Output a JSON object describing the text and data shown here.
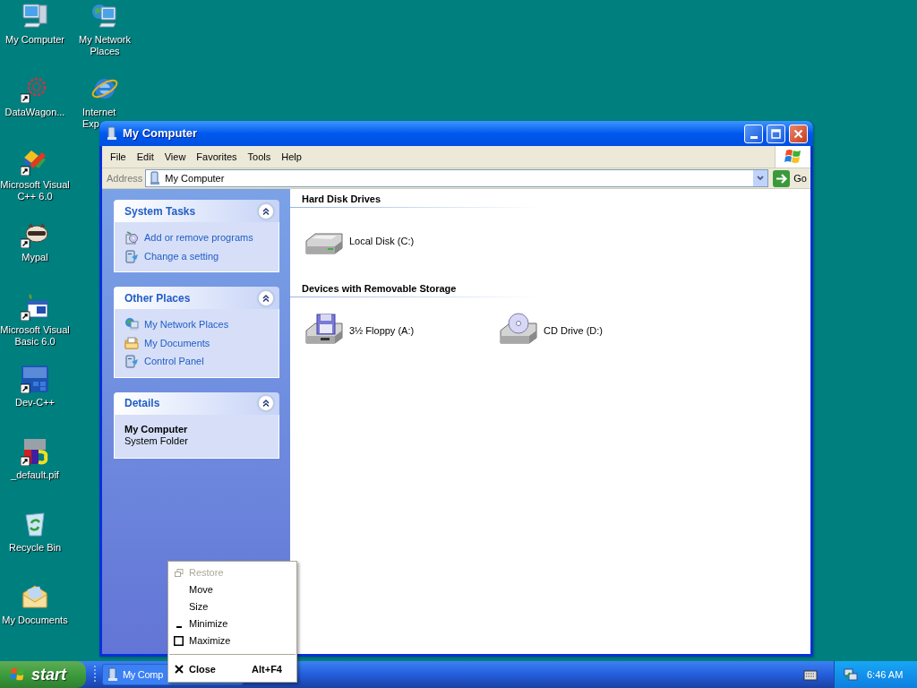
{
  "desktop_icons": [
    {
      "kind": "computer",
      "label": [
        "My Computer"
      ],
      "covered": false
    },
    {
      "kind": "gear-shortcut",
      "label": [
        "DataWagon..."
      ],
      "covered": false
    },
    {
      "kind": "cube-shortcut",
      "label": [
        "Microsoft Visual",
        "C++ 6.0"
      ],
      "covered": false
    },
    {
      "kind": "raccoon-shortcut",
      "label": [
        "Mypal"
      ],
      "covered": false
    },
    {
      "kind": "window-shortcut",
      "label": [
        "Microsoft Visual",
        "Basic 6.0"
      ],
      "covered": false
    },
    {
      "kind": "tile-shortcut",
      "label": [
        "Dev-C++"
      ],
      "covered": false
    },
    {
      "kind": "dos-shortcut",
      "label": [
        "_default.pif"
      ],
      "covered": false
    },
    {
      "kind": "recycle",
      "label": [
        "Recycle Bin"
      ],
      "covered": false
    },
    {
      "kind": "documents",
      "label": [
        "My Documents"
      ],
      "covered": false
    },
    {
      "kind": "network",
      "label": [
        "My Network",
        "Places"
      ],
      "covered": false
    },
    {
      "kind": "globe",
      "label": [
        "Internet",
        "Exp"
      ],
      "covered": true
    }
  ],
  "window": {
    "title": "My Computer",
    "menu": [
      "File",
      "Edit",
      "View",
      "Favorites",
      "Tools",
      "Help"
    ],
    "address": {
      "label": "Address",
      "value": "My Computer",
      "go": "Go"
    },
    "task_panels": [
      {
        "kind": "links",
        "title": "System Tasks",
        "expanded": true,
        "items": [
          {
            "kind": "programs",
            "label": "Add or remove programs"
          },
          {
            "kind": "settings",
            "label": "Change a setting"
          }
        ]
      },
      {
        "kind": "links",
        "title": "Other Places",
        "expanded": true,
        "items": [
          {
            "kind": "network",
            "label": "My Network Places"
          },
          {
            "kind": "documents",
            "label": "My Documents"
          },
          {
            "kind": "settings",
            "label": "Control Panel"
          }
        ]
      },
      {
        "kind": "details",
        "title": "Details",
        "expanded": true,
        "name": "My Computer",
        "description": "System Folder"
      }
    ],
    "sections": [
      {
        "title": "Hard Disk Drives",
        "items": [
          {
            "kind": "hard-disk",
            "label": "Local Disk (C:)"
          }
        ]
      },
      {
        "title": "Devices with Removable Storage",
        "items": [
          {
            "kind": "floppy",
            "label": "3½ Floppy (A:)"
          },
          {
            "kind": "cd",
            "label": "CD Drive (D:)"
          }
        ]
      }
    ]
  },
  "system_menu": [
    {
      "kind": "restore",
      "label": "Restore",
      "disabled": true
    },
    {
      "kind": "plain",
      "label": "Move",
      "disabled": false
    },
    {
      "kind": "plain",
      "label": "Size",
      "disabled": false
    },
    {
      "kind": "minimize",
      "label": "Minimize",
      "disabled": false
    },
    {
      "kind": "maximize",
      "label": "Maximize",
      "disabled": false
    },
    {
      "kind": "separator"
    },
    {
      "kind": "close",
      "label": "Close",
      "shortcut": "Alt+F4",
      "disabled": false
    }
  ],
  "taskbar": {
    "start": "start",
    "tasks": [
      {
        "label": "My Comp"
      }
    ],
    "clock": "6:46 AM"
  }
}
